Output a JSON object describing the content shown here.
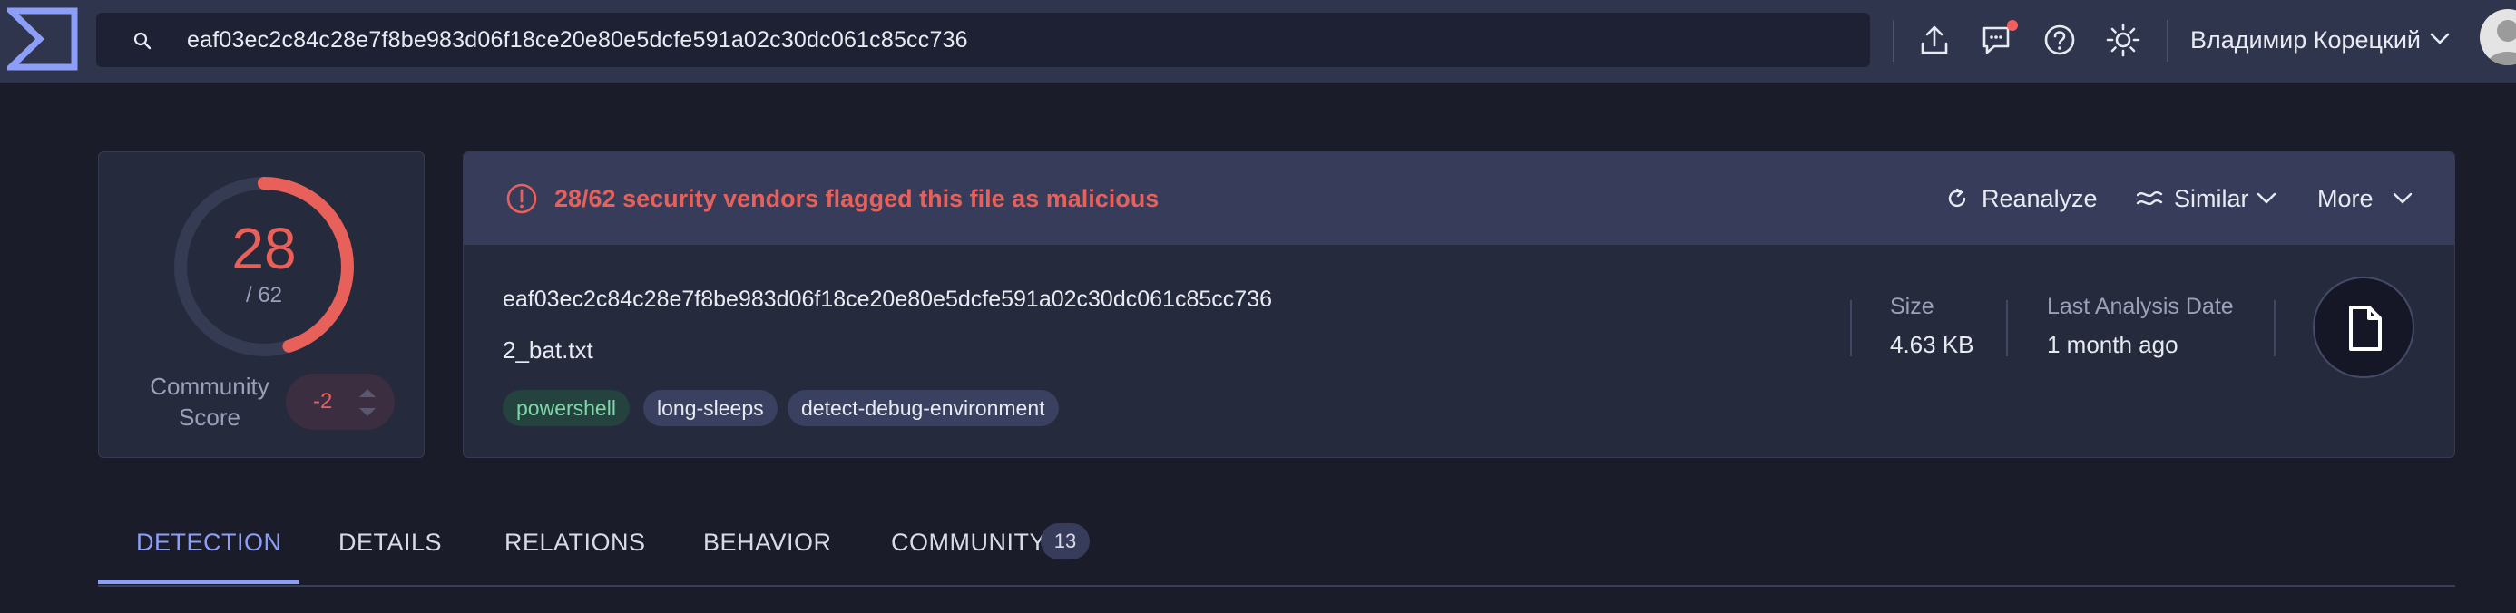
{
  "search": {
    "query": "eaf03ec2c84c28e7f8be983d06f18ce20e80e5dcfe591a02c30dc061c85cc736"
  },
  "header": {
    "user_name": "Владимир Корецкий",
    "icons": [
      "upload-icon",
      "chat-icon",
      "help-icon",
      "theme-icon"
    ]
  },
  "score": {
    "detected": "28",
    "total": "/ 62",
    "detected_fraction": 0.4516,
    "community_label": "Community Score",
    "community_value": "-2",
    "color_malicious": "#e8605a"
  },
  "alert": {
    "text": "28/62 security vendors flagged this file as malicious"
  },
  "actions": {
    "reanalyze": "Reanalyze",
    "similar": "Similar",
    "more": "More"
  },
  "file": {
    "hash": "eaf03ec2c84c28e7f8be983d06f18ce20e80e5dcfe591a02c30dc061c85cc736",
    "name": "2_bat.txt",
    "tags": [
      "powershell",
      "long-sleeps",
      "detect-debug-environment"
    ],
    "size_label": "Size",
    "size_value": "4.63 KB",
    "date_label": "Last Analysis Date",
    "date_value": "1 month ago"
  },
  "tabs": {
    "detection": "DETECTION",
    "details": "DETAILS",
    "relations": "RELATIONS",
    "behavior": "BEHAVIOR",
    "community": "COMMUNITY",
    "community_count": "13"
  }
}
